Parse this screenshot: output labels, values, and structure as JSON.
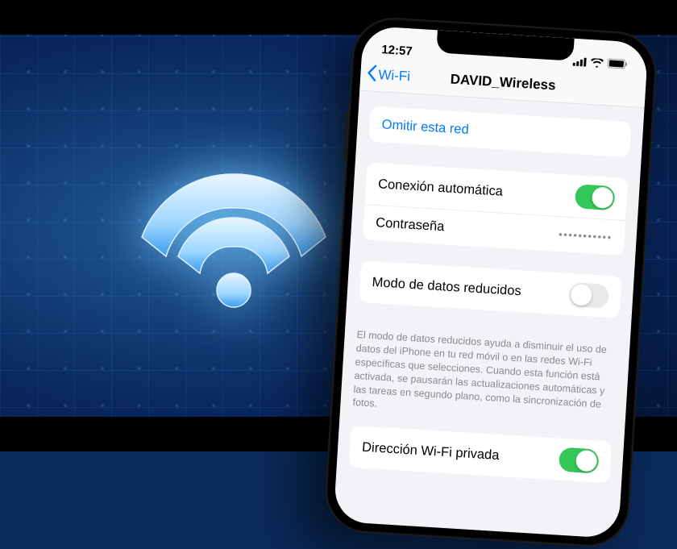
{
  "status": {
    "time": "12:57"
  },
  "nav": {
    "back_label": "Wi-Fi",
    "title": "DAVID_Wireless"
  },
  "forget": {
    "label": "Omitir esta red"
  },
  "auto_join": {
    "label": "Conexión automática",
    "on": true
  },
  "password": {
    "label": "Contraseña",
    "masked": "•••••••••••"
  },
  "low_data": {
    "label": "Modo de datos reducidos",
    "on": false,
    "footer": "El modo de datos reducidos ayuda a disminuir el uso de datos del iPhone en tu red móvil o en las redes Wi-Fi específicas que selecciones. Cuando esta función está activada, se pausarán las actualizaciones automáticas y las tareas en segundo plano, como la sincronización de fotos."
  },
  "private_addr": {
    "label": "Dirección Wi-Fi privada",
    "on": true
  },
  "colors": {
    "ios_blue": "#007aff",
    "ios_green": "#34c759",
    "grouped_bg": "#f2f2f7"
  }
}
